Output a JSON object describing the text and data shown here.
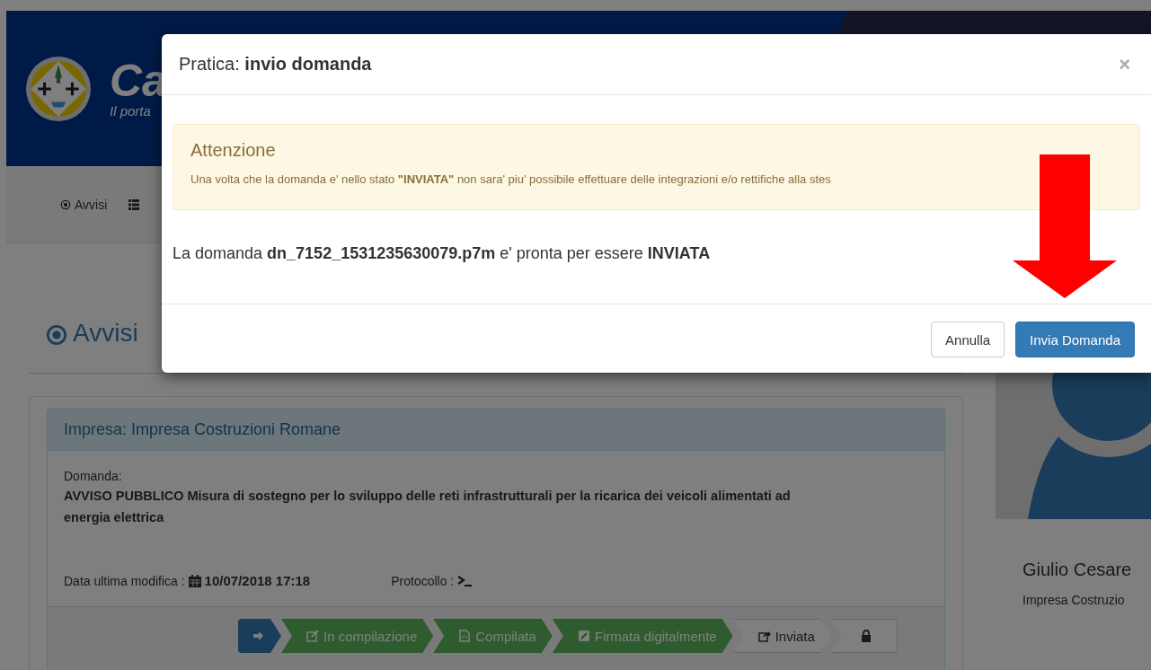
{
  "header": {
    "logo_text": "Ca",
    "tagline": "Il porta"
  },
  "nav": {
    "items": [
      {
        "label": "Avvisi"
      }
    ]
  },
  "page_title": "Avvisi",
  "card": {
    "company_label": "Impresa:",
    "company": "Impresa Costruzioni Romane",
    "domanda_label": "Domanda:",
    "domanda": "AVVISO PUBBLICO Misura di sostegno per lo sviluppo delle reti infrastrutturali per la ricarica dei veicoli alimentati ad energia elettrica",
    "date_label": "Data ultima modifica :",
    "date": "10/07/2018 17:18",
    "protocol_label": "Protocollo :"
  },
  "steps": [
    {
      "selected": true,
      "done": false
    },
    {
      "label": "In compilazione",
      "selected": false,
      "done": true
    },
    {
      "label": "Compilata",
      "selected": false,
      "done": true
    },
    {
      "label": "Firmata digitalmente",
      "selected": false,
      "done": true
    },
    {
      "label": "Inviata",
      "selected": false,
      "done": false
    },
    {
      "selected": false,
      "done": false
    }
  ],
  "profile": {
    "name": "Giulio Cesare",
    "company": "Impresa Costruzio"
  },
  "modal": {
    "title": "Pratica: **invio domanda**",
    "close": "×",
    "alert": {
      "title": "Attenzione",
      "text": "Una volta che la domanda e' nello stato **\"INVIATA\"** non sara' piu' possibile effettuare delle integrazioni e/o rettifiche alla stes"
    },
    "message": "La domanda **dn_7152_1531235630079.p7m** e' pronta per essere **INVIATA**",
    "buttons": [
      {
        "label": "Annulla",
        "kind": "default"
      },
      {
        "label": "Invia Domanda",
        "kind": "primary"
      }
    ]
  }
}
